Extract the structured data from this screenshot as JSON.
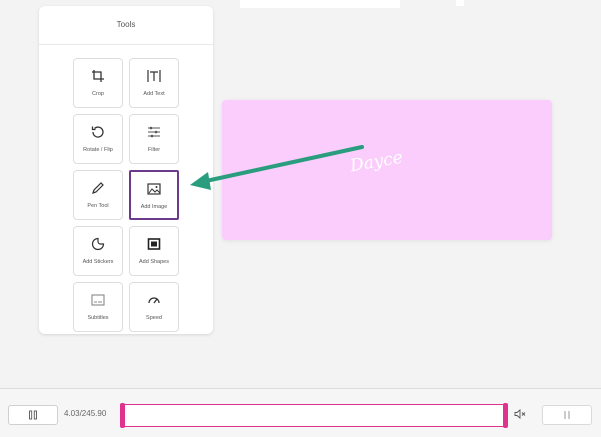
{
  "panel": {
    "title": "Tools"
  },
  "tools": [
    {
      "label": "Crop",
      "icon": "crop-icon"
    },
    {
      "label": "Add Text",
      "icon": "text-icon"
    },
    {
      "label": "Rotate / Flip",
      "icon": "rotate-icon"
    },
    {
      "label": "Filter",
      "icon": "filter-icon"
    },
    {
      "label": "Pen Tool",
      "icon": "pen-icon"
    },
    {
      "label": "Add Image",
      "icon": "image-icon"
    },
    {
      "label": "Add Stickers",
      "icon": "sticker-icon"
    },
    {
      "label": "Add Shapes",
      "icon": "shape-icon"
    },
    {
      "label": "Subtitles",
      "icon": "subtitles-icon"
    },
    {
      "label": "Speed",
      "icon": "speed-icon"
    }
  ],
  "canvas": {
    "script_text": "Dayce",
    "background": "#facdfc"
  },
  "player": {
    "time": "4.03/245.90"
  },
  "colors": {
    "accent": "#e0338d",
    "arrow": "#2a9d7f",
    "highlight": "#6b3a8c"
  }
}
